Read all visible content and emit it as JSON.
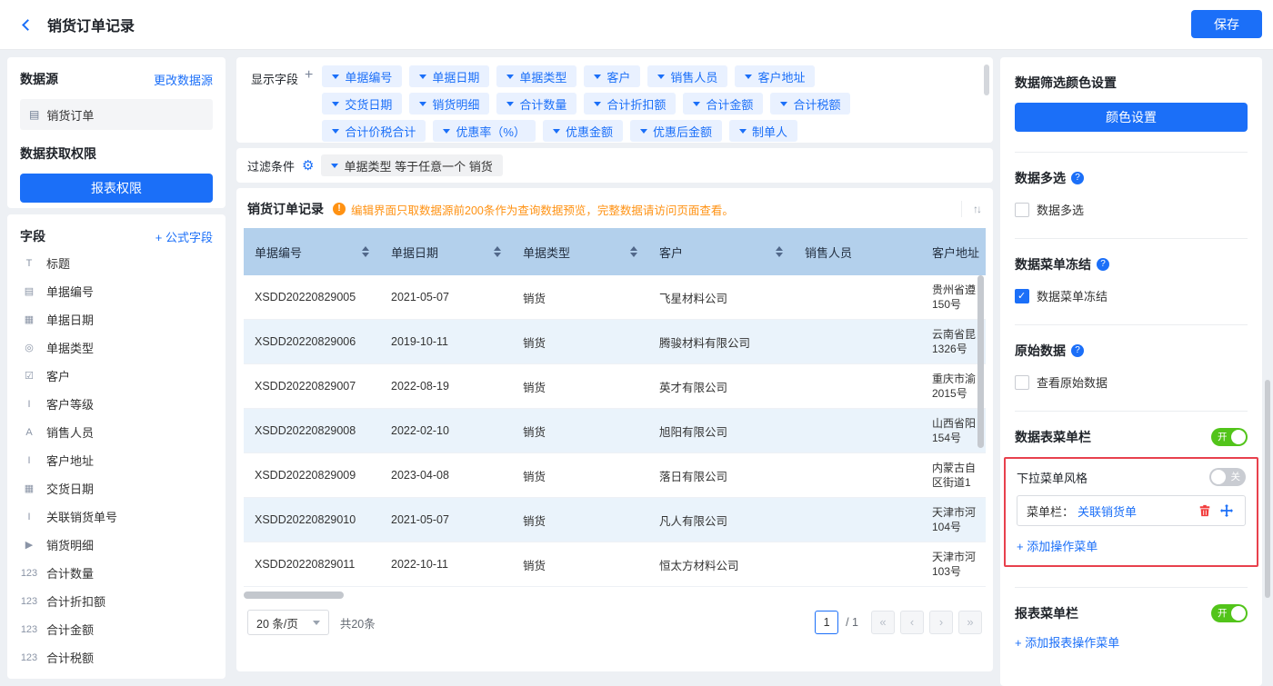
{
  "colors": {
    "accent": "#1b6ff8",
    "chip_bg": "#e9f1ff",
    "table_header_bg": "#b3d0ec",
    "row_alt_bg": "#eaf3fb",
    "warning": "#ff9213",
    "toggle_on_green": "#52c41a",
    "highlight_red": "#e8414d"
  },
  "topbar": {
    "title": "销货订单记录",
    "save_label": "保存"
  },
  "left": {
    "datasource_title": "数据源",
    "change_datasource_link": "更改数据源",
    "datasource_icon": "▤",
    "datasource_item": "销货订单",
    "permission_title": "数据获取权限",
    "permission_button": "报表权限",
    "fields_title": "字段",
    "formula_field_link": "+ 公式字段",
    "fields": [
      {
        "icon": "T",
        "label": "标题"
      },
      {
        "icon": "▤",
        "label": "单据编号"
      },
      {
        "icon": "▦",
        "label": "单据日期"
      },
      {
        "icon": "◎",
        "label": "单据类型"
      },
      {
        "icon": "☑",
        "label": "客户"
      },
      {
        "icon": "I",
        "label": "客户等级"
      },
      {
        "icon": "A",
        "label": "销售人员"
      },
      {
        "icon": "I",
        "label": "客户地址"
      },
      {
        "icon": "▦",
        "label": "交货日期"
      },
      {
        "icon": "I",
        "label": "关联销货单号"
      },
      {
        "icon": "▶",
        "label": "销货明细"
      },
      {
        "icon": "123",
        "label": "合计数量"
      },
      {
        "icon": "123",
        "label": "合计折扣额"
      },
      {
        "icon": "123",
        "label": "合计金额"
      },
      {
        "icon": "123",
        "label": "合计税额"
      }
    ]
  },
  "display_fields": {
    "label": "显示字段",
    "add_button": "+",
    "row1": [
      "单据编号",
      "单据日期",
      "单据类型",
      "客户",
      "销售人员",
      "客户地址"
    ],
    "row2": [
      "交货日期",
      "销货明细",
      "合计数量",
      "合计折扣额",
      "合计金额",
      "合计税额"
    ],
    "row3": [
      "合计价税合计",
      "优惠率（%）",
      "优惠金额",
      "优惠后金额",
      "制单人"
    ]
  },
  "filter": {
    "label": "过滤条件",
    "gear_icon": "⚙",
    "condition": "单据类型 等于任意一个 销货"
  },
  "table": {
    "title": "销货订单记录",
    "warning": "编辑界面只取数据源前200条作为查询数据预览，完整数据请访问页面查看。",
    "sort_icon": "↑↓",
    "columns": [
      "单据编号",
      "单据日期",
      "单据类型",
      "客户",
      "销售人员",
      "客户地址"
    ],
    "rows": [
      {
        "no": "XSDD20220829005",
        "date": "2021-05-07",
        "type": "销货",
        "customer": "飞星材料公司",
        "salesperson": "",
        "addr1": "贵州省遵",
        "addr2": "150号"
      },
      {
        "no": "XSDD20220829006",
        "date": "2019-10-11",
        "type": "销货",
        "customer": "腾骏材料有限公司",
        "salesperson": "",
        "addr1": "云南省昆",
        "addr2": "1326号"
      },
      {
        "no": "XSDD20220829007",
        "date": "2022-08-19",
        "type": "销货",
        "customer": "英才有限公司",
        "salesperson": "",
        "addr1": "重庆市渝",
        "addr2": "2015号"
      },
      {
        "no": "XSDD20220829008",
        "date": "2022-02-10",
        "type": "销货",
        "customer": "旭阳有限公司",
        "salesperson": "",
        "addr1": "山西省阳",
        "addr2": "154号"
      },
      {
        "no": "XSDD20220829009",
        "date": "2023-04-08",
        "type": "销货",
        "customer": "落日有限公司",
        "salesperson": "",
        "addr1": "内蒙古自",
        "addr2": "区街道1"
      },
      {
        "no": "XSDD20220829010",
        "date": "2021-05-07",
        "type": "销货",
        "customer": "凡人有限公司",
        "salesperson": "",
        "addr1": "天津市河",
        "addr2": "104号"
      },
      {
        "no": "XSDD20220829011",
        "date": "2022-10-11",
        "type": "销货",
        "customer": "恒太方材料公司",
        "salesperson": "",
        "addr1": "天津市河",
        "addr2": "103号"
      }
    ],
    "pagination": {
      "page_size": "20 条/页",
      "total": "共20条",
      "current_page": "1",
      "page_count": "/ 1",
      "first_icon": "«",
      "prev_icon": "‹",
      "next_icon": "›",
      "last_icon": "»"
    }
  },
  "right_panel": {
    "color_section_title": "数据筛选颜色设置",
    "color_button": "颜色设置",
    "multi_select_title": "数据多选",
    "multi_select_checkbox": "数据多选",
    "menu_freeze_title": "数据菜单冻结",
    "menu_freeze_checkbox": "数据菜单冻结",
    "raw_data_title": "原始数据",
    "raw_data_checkbox": "查看原始数据",
    "table_menu_title": "数据表菜单栏",
    "toggle_on_label": "开",
    "toggle_off_label": "关",
    "dropdown_style_label": "下拉菜单风格",
    "menu_item_prefix": "菜单栏：",
    "menu_item_value": "关联销货单",
    "add_action_link": "+ 添加操作菜单",
    "report_menu_title": "报表菜单栏",
    "add_report_action_link": "+ 添加报表操作菜单"
  }
}
